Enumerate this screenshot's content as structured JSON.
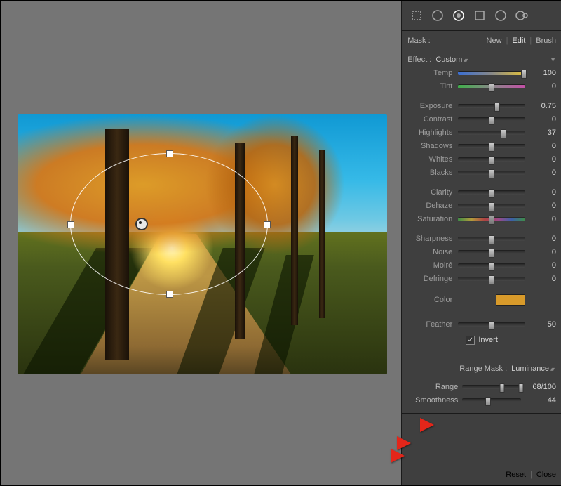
{
  "mask": {
    "label": "Mask :",
    "new": "New",
    "edit": "Edit",
    "brush": "Brush"
  },
  "effect": {
    "label": "Effect :",
    "selected": "Custom"
  },
  "sliders": {
    "temp": {
      "label": "Temp",
      "value": "100",
      "pos": 98
    },
    "tint": {
      "label": "Tint",
      "value": "0",
      "pos": 50
    },
    "exposure": {
      "label": "Exposure",
      "value": "0.75",
      "pos": 58
    },
    "contrast": {
      "label": "Contrast",
      "value": "0",
      "pos": 50
    },
    "highlights": {
      "label": "Highlights",
      "value": "37",
      "pos": 68
    },
    "shadows": {
      "label": "Shadows",
      "value": "0",
      "pos": 50
    },
    "whites": {
      "label": "Whites",
      "value": "0",
      "pos": 50
    },
    "blacks": {
      "label": "Blacks",
      "value": "0",
      "pos": 50
    },
    "clarity": {
      "label": "Clarity",
      "value": "0",
      "pos": 50
    },
    "dehaze": {
      "label": "Dehaze",
      "value": "0",
      "pos": 50
    },
    "saturation": {
      "label": "Saturation",
      "value": "0",
      "pos": 50
    },
    "sharpness": {
      "label": "Sharpness",
      "value": "0",
      "pos": 50
    },
    "noise": {
      "label": "Noise",
      "value": "0",
      "pos": 50
    },
    "moire": {
      "label": "Moiré",
      "value": "0",
      "pos": 50
    },
    "defringe": {
      "label": "Defringe",
      "value": "0",
      "pos": 50
    },
    "feather": {
      "label": "Feather",
      "value": "50",
      "pos": 50
    }
  },
  "color": {
    "label": "Color",
    "swatch": "#d89a2a"
  },
  "invert": {
    "label": "Invert",
    "checked": true
  },
  "rangeMask": {
    "label": "Range Mask :",
    "selected": "Luminance",
    "range": {
      "label": "Range",
      "value": "68/100",
      "lo": 68,
      "hi": 100
    },
    "smoothness": {
      "label": "Smoothness",
      "value": "44",
      "pos": 44
    }
  },
  "footer": {
    "reset": "Reset",
    "close": "Close"
  }
}
